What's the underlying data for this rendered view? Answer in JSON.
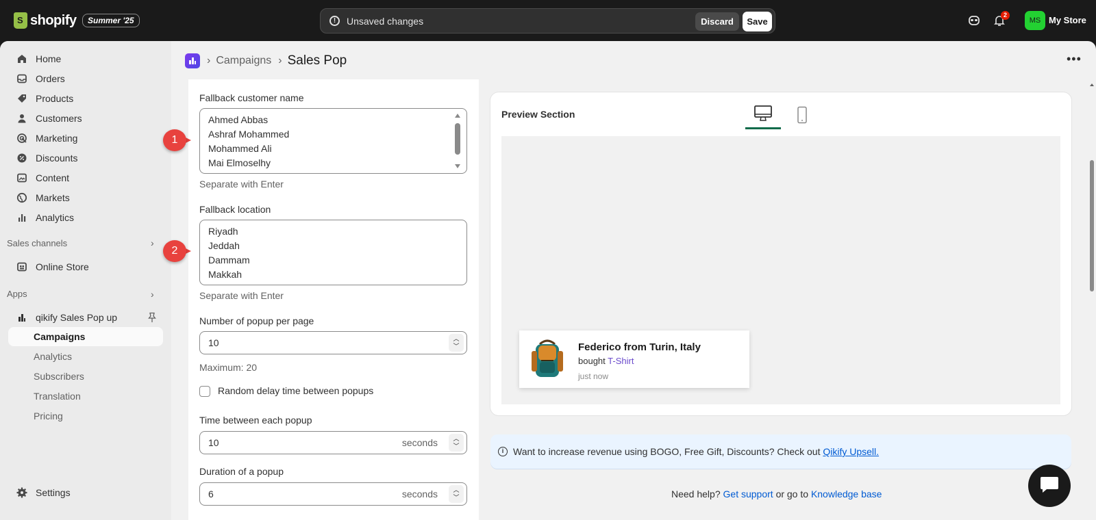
{
  "topbar": {
    "brand": "shopify",
    "edition_badge": "Summer '25",
    "unsaved_message": "Unsaved changes",
    "discard_label": "Discard",
    "save_label": "Save",
    "notification_count": "2",
    "avatar_initials": "MS",
    "store_name": "My Store",
    "avatar_color": "#23d132"
  },
  "sidebar": {
    "main_items": [
      {
        "label": "Home",
        "icon": "home-icon"
      },
      {
        "label": "Orders",
        "icon": "inbox-icon"
      },
      {
        "label": "Products",
        "icon": "tag-icon"
      },
      {
        "label": "Customers",
        "icon": "person-icon"
      },
      {
        "label": "Marketing",
        "icon": "target-icon"
      },
      {
        "label": "Discounts",
        "icon": "discount-icon"
      },
      {
        "label": "Content",
        "icon": "image-icon"
      },
      {
        "label": "Markets",
        "icon": "globe-icon"
      },
      {
        "label": "Analytics",
        "icon": "bar-chart-icon"
      }
    ],
    "sales_channels_header": "Sales channels",
    "online_store": "Online Store",
    "apps_header": "Apps",
    "app_name": "qikify Sales Pop up",
    "app_sub_items": [
      "Campaigns",
      "Analytics",
      "Subscribers",
      "Translation",
      "Pricing"
    ],
    "settings": "Settings"
  },
  "breadcrumb": {
    "parent": "Campaigns",
    "current": "Sales Pop"
  },
  "form": {
    "fallback_name_label": "Fallback customer name",
    "fallback_names": [
      "Ahmed Abbas",
      "Ashraf Mohammed",
      "Mohammed Ali",
      "Mai Elmoselhy"
    ],
    "fallback_name_help": "Separate with Enter",
    "fallback_location_label": "Fallback location",
    "fallback_locations": [
      "Riyadh",
      "Jeddah",
      "Dammam",
      "Makkah"
    ],
    "fallback_location_help": "Separate with Enter",
    "popup_per_page_label": "Number of popup per page",
    "popup_per_page_value": "10",
    "popup_per_page_help": "Maximum: 20",
    "random_delay_label": "Random delay time between popups",
    "random_delay_checked": false,
    "time_between_label": "Time between each popup",
    "time_between_value": "10",
    "time_between_suffix": "seconds",
    "duration_label": "Duration of a popup",
    "duration_value": "6",
    "duration_suffix": "seconds"
  },
  "annotations": [
    "1",
    "2"
  ],
  "preview": {
    "title": "Preview Section",
    "popup_title": "Federico from Turin, Italy",
    "popup_bought": "bought",
    "popup_product": "T-Shirt",
    "popup_time": "just now"
  },
  "banner": {
    "text": "Want to increase revenue using BOGO, Free Gift, Discounts? Check out",
    "link": "Qikify Upsell."
  },
  "help": {
    "prefix": "Need help?",
    "support_link": "Get support",
    "middle": "or go to",
    "kb_link": "Knowledge base"
  },
  "colors": {
    "accent_tab": "#0e6b4a",
    "marker": "#e8423e",
    "link": "#005bd3",
    "product_link": "#6b4bcc"
  }
}
